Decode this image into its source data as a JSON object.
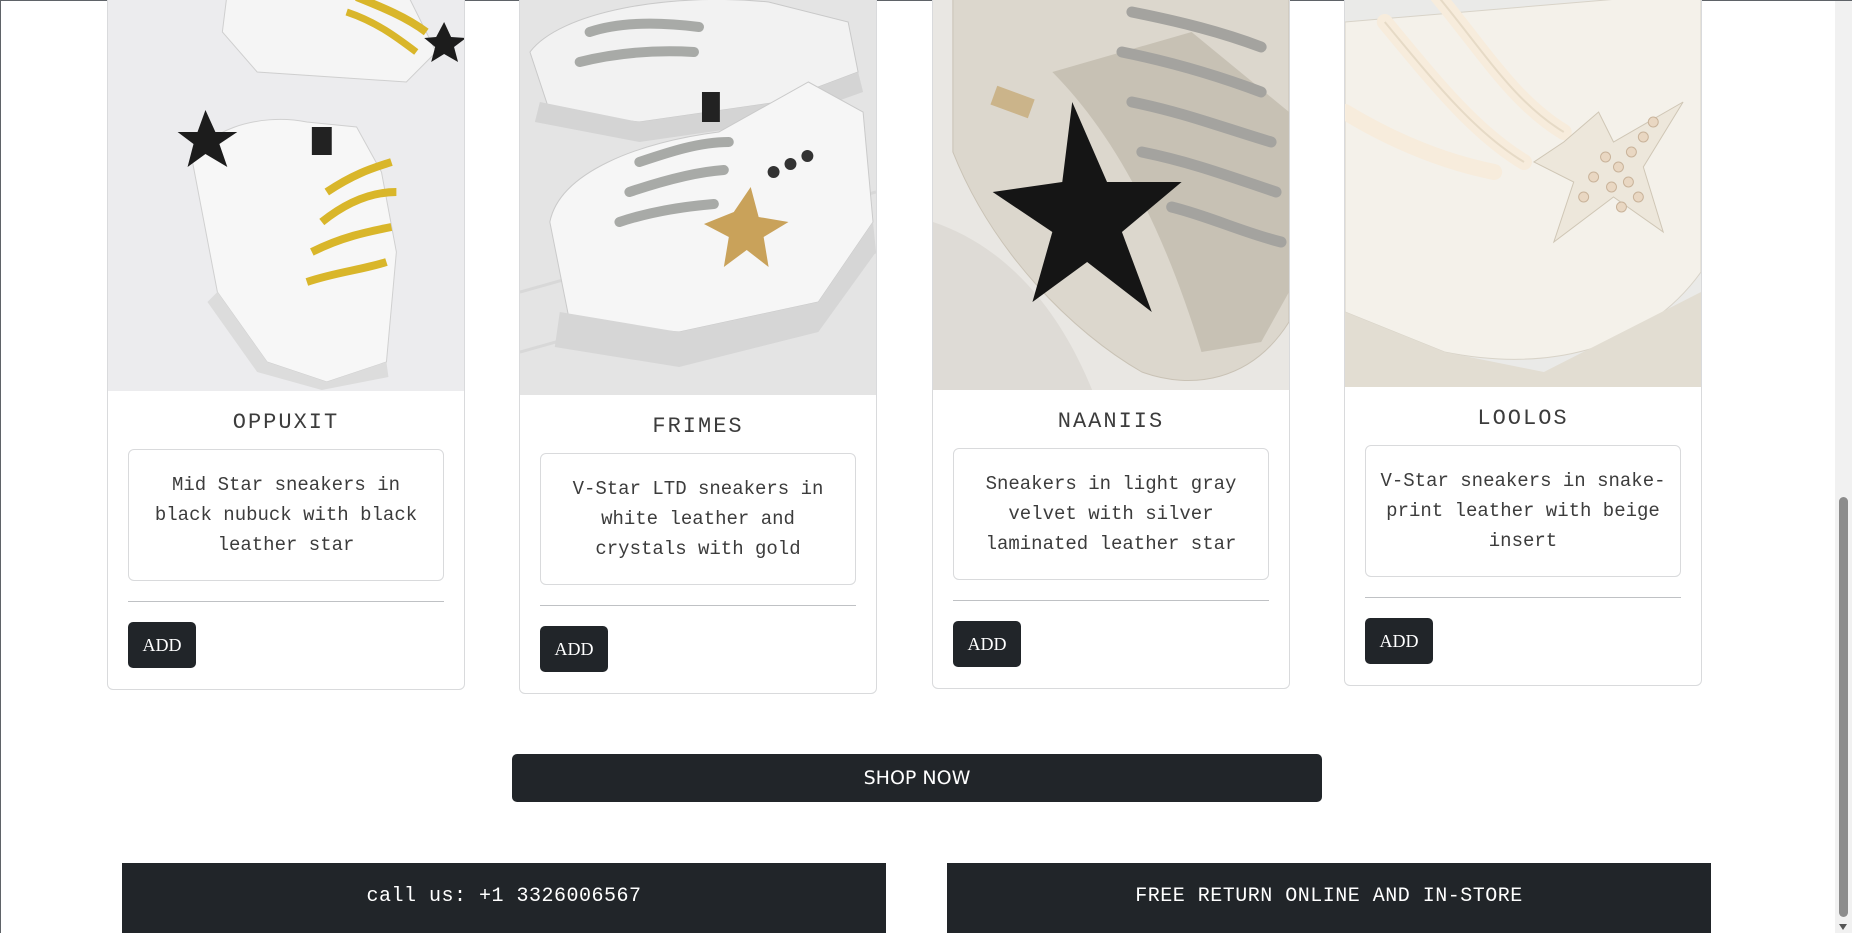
{
  "products": [
    {
      "name": "OPPUXIT",
      "description": "Mid Star sneakers in black nubuck with black leather star",
      "button": "ADD",
      "image": "sneaker-black-star-yellow-laces"
    },
    {
      "name": "FRIMES",
      "description": "V-Star LTD sneakers in white leather and crystals with gold",
      "button": "ADD",
      "image": "sneaker-gold-star-gray-laces"
    },
    {
      "name": "NAANIIS",
      "description": "Sneakers in light gray velvet with silver laminated leather star",
      "button": "ADD",
      "image": "sneaker-silver-black-star"
    },
    {
      "name": "LOOLOS",
      "description": "V-Star sneakers in snake-print leather with beige insert",
      "button": "ADD",
      "image": "sneaker-pearl-star"
    }
  ],
  "cta": {
    "label": "SHOP NOW"
  },
  "footer": {
    "contact": "call us: +1 3326006567",
    "returns": "FREE RETURN ONLINE AND IN-STORE"
  },
  "colors": {
    "dark": "#212529",
    "border": "#d9dadc",
    "text": "#3c3c3c"
  }
}
